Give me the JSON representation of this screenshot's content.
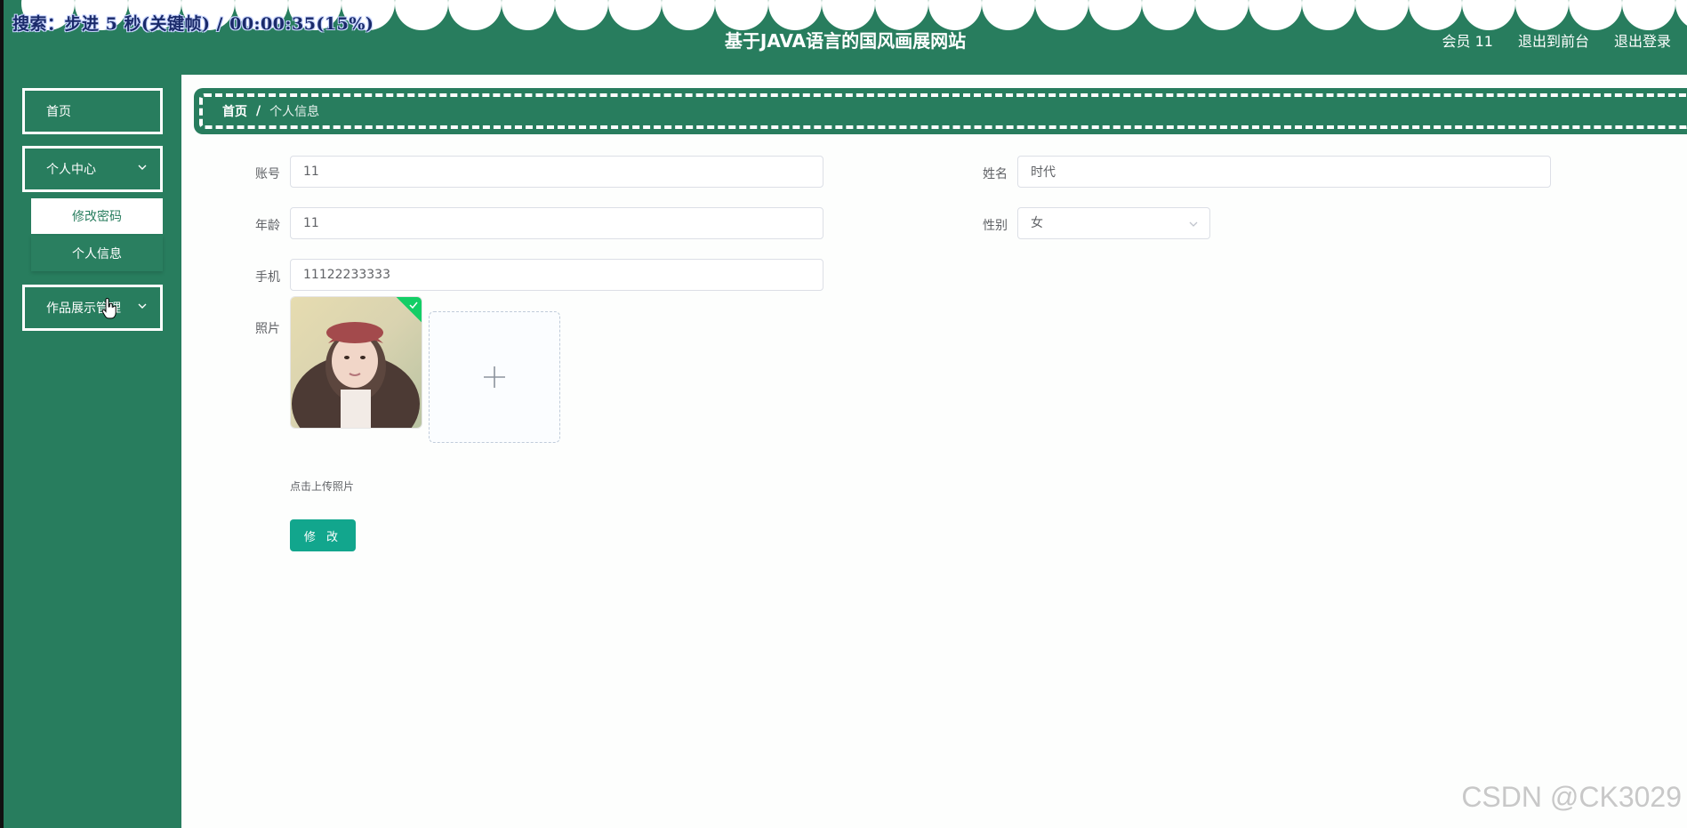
{
  "overlay": {
    "search_status": "搜索：步进 5 秒(关键帧) / 00:00:35(15%)"
  },
  "header": {
    "title": "基于JAVA语言的国风画展网站",
    "user_label": "会员 11",
    "to_front_label": "退出到前台",
    "logout_label": "退出登录"
  },
  "sidebar": {
    "items": [
      {
        "label": "首页"
      },
      {
        "label": "个人中心",
        "icon": "chevron-down-icon"
      },
      {
        "label": "作品展示管理",
        "icon": "chevron-down-icon"
      }
    ],
    "submenu": [
      {
        "label": "修改密码"
      },
      {
        "label": "个人信息"
      }
    ]
  },
  "breadcrumb": {
    "home": "首页",
    "separator": "/",
    "current": "个人信息"
  },
  "form": {
    "account_label": "账号",
    "account_value": "11",
    "name_label": "姓名",
    "name_value": "时代",
    "age_label": "年龄",
    "age_value": "11",
    "gender_label": "性别",
    "gender_value": "女",
    "phone_label": "手机",
    "phone_value": "11122233333",
    "photo_label": "照片",
    "upload_tip": "点击上传照片",
    "submit_label": "修 改"
  },
  "watermark": "CSDN @CK3029",
  "colors": {
    "primary": "#287d5e",
    "button": "#12a68d"
  }
}
